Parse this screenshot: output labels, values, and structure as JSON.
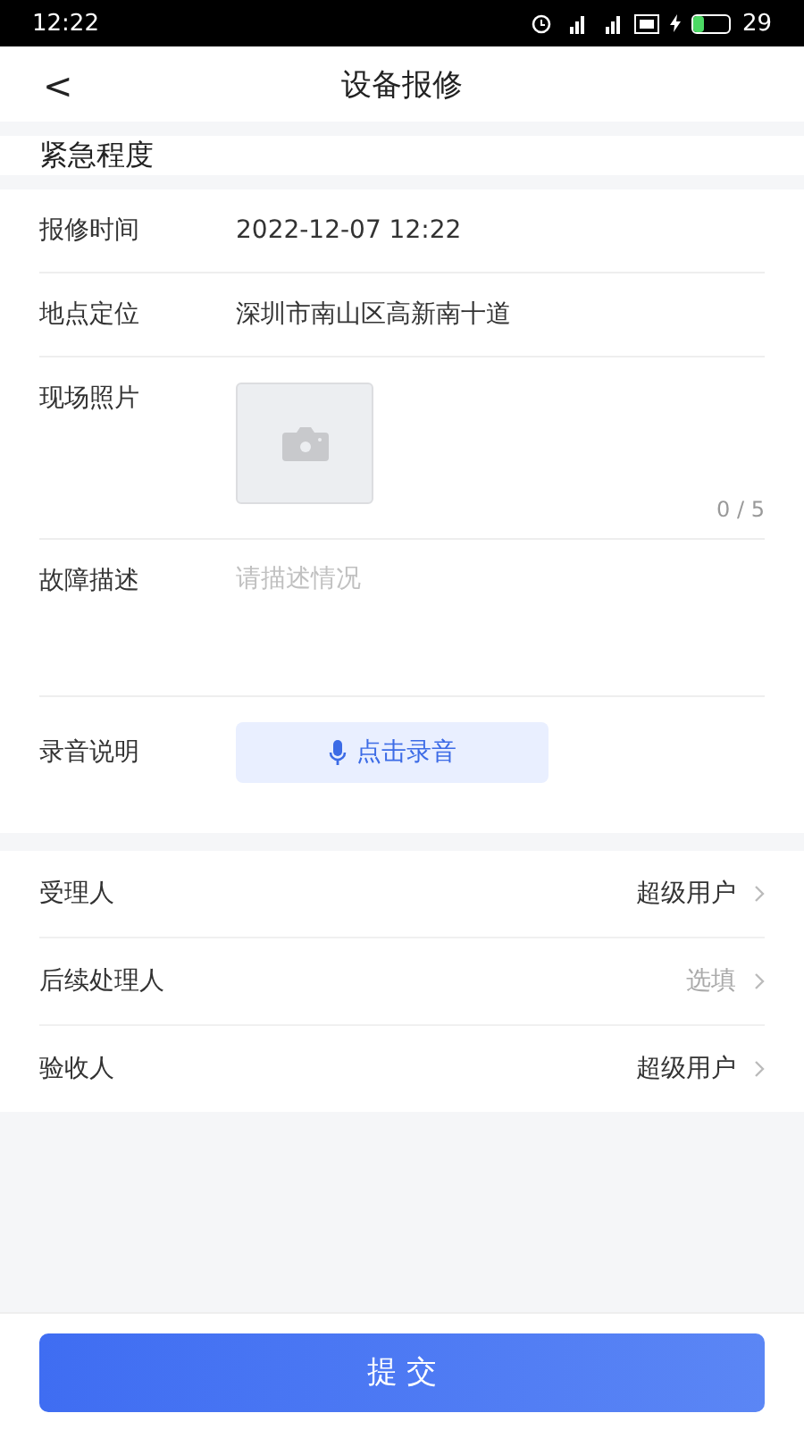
{
  "status_bar": {
    "time": "12:22",
    "battery": "29"
  },
  "nav": {
    "back": "<",
    "title": "设备报修"
  },
  "section": {
    "title": "紧急程度"
  },
  "form": {
    "date": {
      "label": "报修时间",
      "value": "2022-12-07 12:22"
    },
    "location": {
      "label": "地点定位",
      "value": "深圳市南山区高新南十道"
    },
    "photos": {
      "label": "现场照片",
      "count": "0 / 5"
    },
    "description": {
      "label": "故障描述",
      "placeholder": "请描述情况"
    },
    "recording": {
      "label": "录音说明",
      "button": "点击录音"
    }
  },
  "pickers": [
    {
      "label": "受理人",
      "value": "超级用户"
    },
    {
      "label": "后续处理人",
      "placeholder": "选填"
    },
    {
      "label": "验收人",
      "value": "超级用户"
    }
  ],
  "submit": "提 交"
}
